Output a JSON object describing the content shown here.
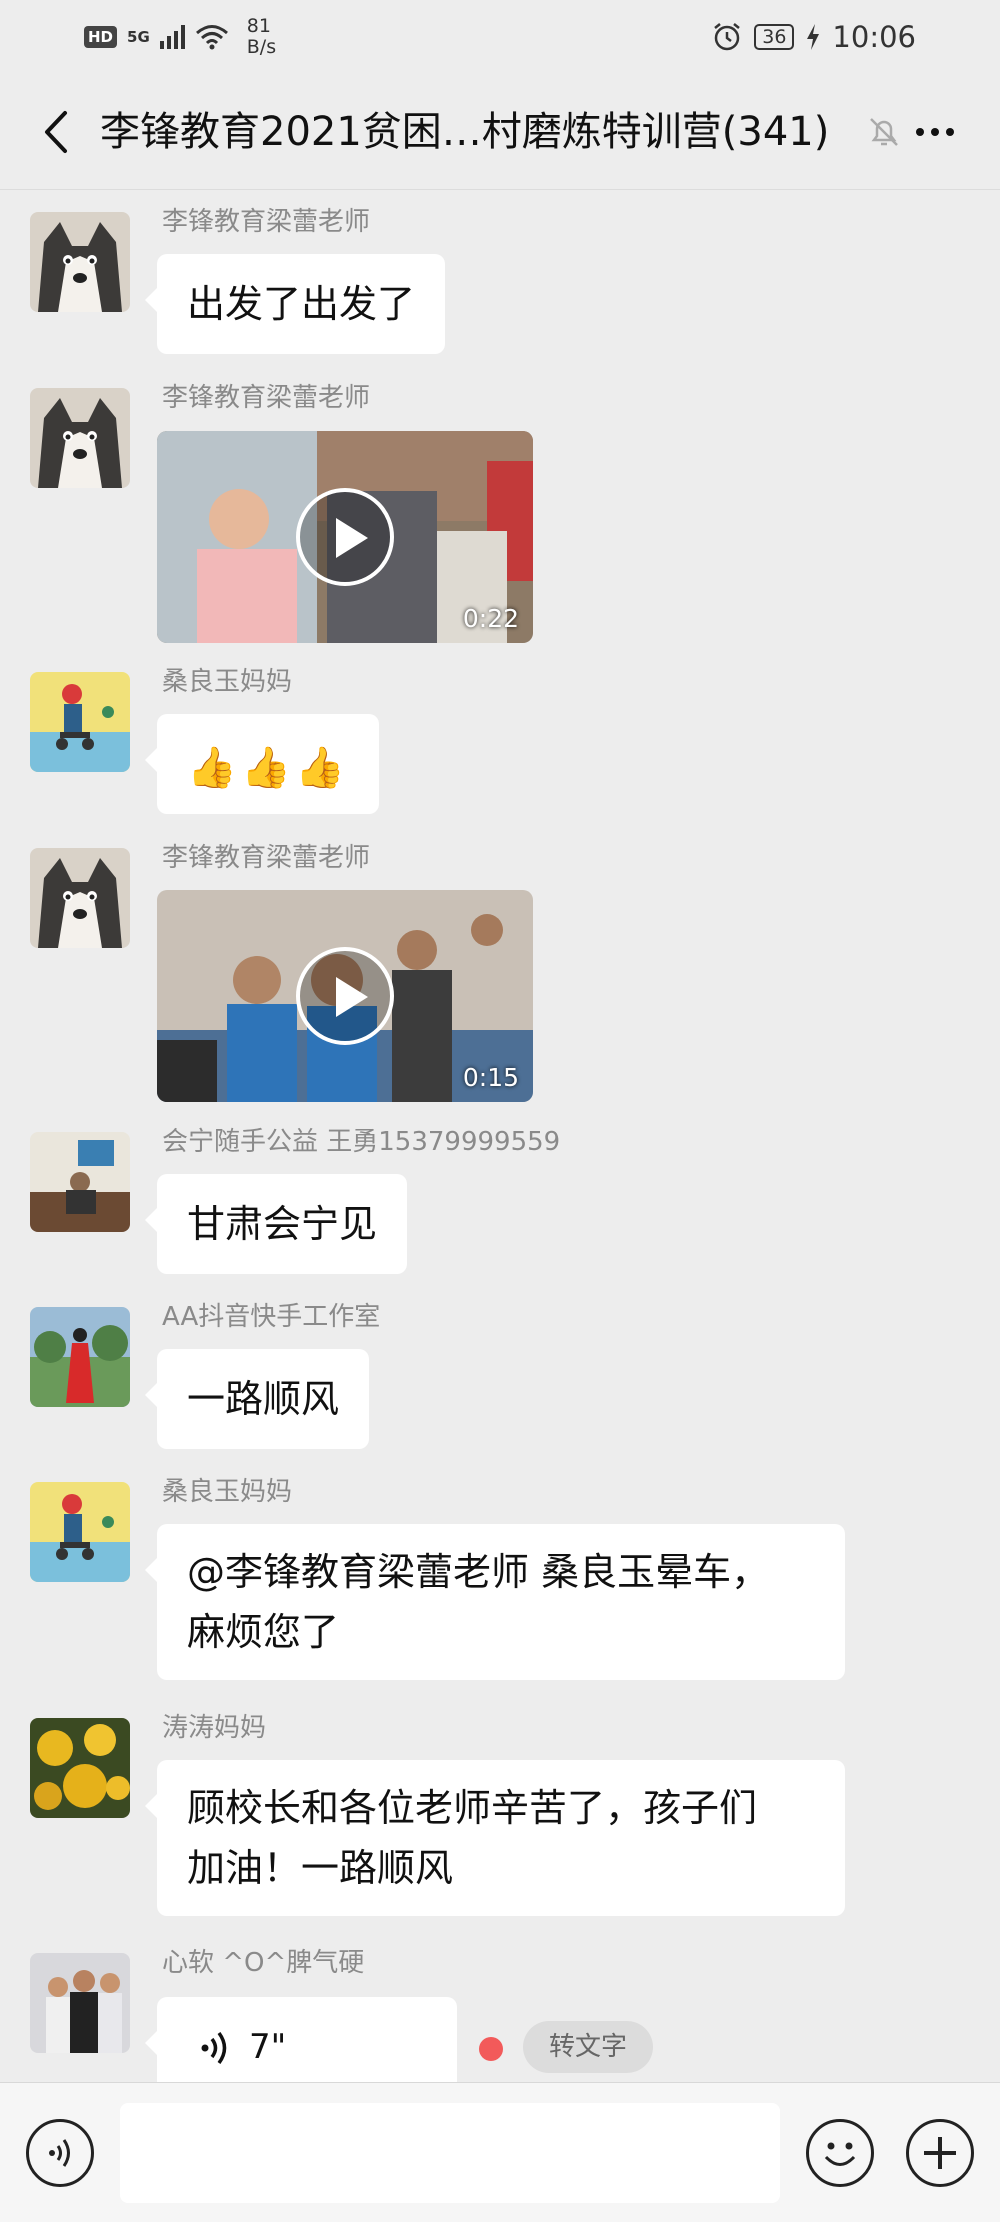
{
  "status_bar": {
    "hd": "HD",
    "network": "5G",
    "speed_value": "81",
    "speed_unit": "B/s",
    "battery": "36",
    "time": "10:06"
  },
  "header": {
    "title": "李锋教育2021贫困…村磨炼特训营(341)",
    "back_icon": "chevron-left-icon",
    "mute_icon": "bell-off-icon",
    "more_icon": "more-dots-icon"
  },
  "messages": [
    {
      "sender": "李锋教育梁蕾老师",
      "type": "text",
      "text": "出发了出发了"
    },
    {
      "sender": "李锋教育梁蕾老师",
      "type": "video",
      "duration": "0:22"
    },
    {
      "sender": "桑良玉妈妈",
      "type": "emoji",
      "emoji": [
        "👍",
        "👍",
        "👍"
      ]
    },
    {
      "sender": "李锋教育梁蕾老师",
      "type": "video",
      "duration": "0:15"
    },
    {
      "sender": "会宁随手公益 王勇15379999559",
      "type": "text",
      "text": "甘肃会宁见"
    },
    {
      "sender": "AA抖音快手工作室",
      "type": "text",
      "text": "一路顺风"
    },
    {
      "sender": "桑良玉妈妈",
      "type": "text",
      "text_line1": "@李锋教育梁蕾老师  桑良玉晕车，",
      "text_line2": "麻烦您了"
    },
    {
      "sender": "涛涛妈妈",
      "type": "text",
      "text_line1": "顾校长和各位老师辛苦了，孩子们",
      "text_line2": "加油！一路顺风"
    },
    {
      "sender": "心软 ^O^脾气硬",
      "type": "voice",
      "duration": "7\"",
      "to_text_label": "转文字"
    }
  ],
  "input_bar": {
    "placeholder": "",
    "voice_icon": "voice-toggle-icon",
    "emoji_icon": "emoji-icon",
    "plus_icon": "plus-icon"
  },
  "colors": {
    "background": "#ededed",
    "bubble": "#ffffff",
    "sender_text": "#8a8a8a",
    "unread_dot": "#f25a5a"
  }
}
